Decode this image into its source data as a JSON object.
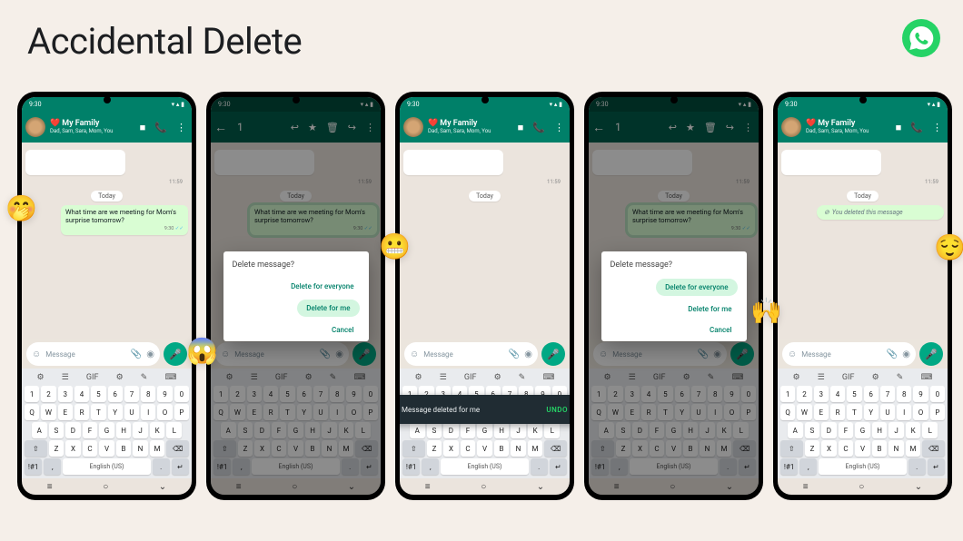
{
  "page": {
    "title": "Accidental Delete"
  },
  "colors": {
    "brand_green": "#25D366",
    "header_teal": "#008069",
    "bg_cream": "#f5efe9"
  },
  "common": {
    "status_time": "9:30",
    "chat_name": "My Family",
    "chat_emoji": "❤️",
    "chat_subtitle": "Dad, Sam, Sara, Mom, You",
    "placeholder_time": "11:59",
    "date_label": "Today",
    "message_text": "What time are we meeting for Mom's surprise tomorrow?",
    "message_time": "9:30",
    "input_placeholder": "Message",
    "keyboard_language": "English (US)",
    "keyboard": {
      "row_nums": [
        "1",
        "2",
        "3",
        "4",
        "5",
        "6",
        "7",
        "8",
        "9",
        "0"
      ],
      "row1": [
        "Q",
        "W",
        "E",
        "R",
        "T",
        "Y",
        "U",
        "I",
        "O",
        "P"
      ],
      "row2": [
        "A",
        "S",
        "D",
        "F",
        "G",
        "H",
        "J",
        "K",
        "L"
      ],
      "row3": [
        "Z",
        "X",
        "C",
        "V",
        "B",
        "N",
        "M"
      ],
      "sym_key": "!#1",
      "comma": ",",
      "period": "."
    }
  },
  "dialog": {
    "title": "Delete message?",
    "delete_everyone": "Delete for everyone",
    "delete_me": "Delete for me",
    "cancel": "Cancel"
  },
  "snackbar": {
    "text": "Message deleted for me",
    "action": "UNDO"
  },
  "deleted_message": "You deleted this message",
  "selection": {
    "count": "1"
  },
  "float_emojis": {
    "p1": "🤭",
    "p2": "😱",
    "p3": "😬",
    "p4": "🙌",
    "p5": "😌"
  }
}
